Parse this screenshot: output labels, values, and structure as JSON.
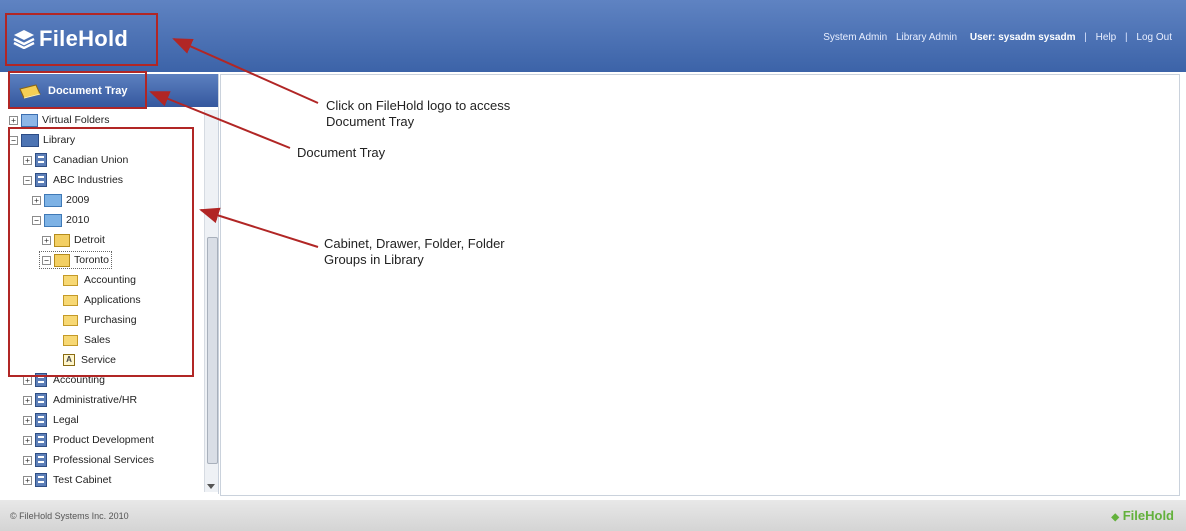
{
  "header": {
    "logo_text": "FileHold",
    "nav": [
      "System Admin",
      "Library Admin"
    ],
    "user_label": "User: sysadm sysadm",
    "separator": "|",
    "help": "Help",
    "logout": "Log Out"
  },
  "sidebar": {
    "document_tray_label": "Document Tray",
    "tree": [
      {
        "label": "Virtual Folders",
        "icon": "virtual-folder-icon",
        "expander": "+"
      },
      {
        "label": "Library",
        "icon": "library-icon",
        "expander": "−"
      },
      {
        "label": "Canadian Union",
        "icon": "cabinet-icon",
        "expander": "+"
      },
      {
        "label": "ABC Industries",
        "icon": "cabinet-icon",
        "expander": "−"
      },
      {
        "label": "2009",
        "icon": "drawer-icon",
        "expander": "+"
      },
      {
        "label": "2010",
        "icon": "drawer-icon",
        "expander": "−"
      },
      {
        "label": "Detroit",
        "icon": "folder-group-icon",
        "expander": "+"
      },
      {
        "label": "Toronto",
        "icon": "folder-group-icon",
        "expander": "−"
      },
      {
        "label": "Accounting",
        "icon": "folder-icon",
        "expander": ""
      },
      {
        "label": "Applications",
        "icon": "folder-icon",
        "expander": ""
      },
      {
        "label": "Purchasing",
        "icon": "folder-icon",
        "expander": ""
      },
      {
        "label": "Sales",
        "icon": "folder-icon",
        "expander": ""
      },
      {
        "label": "Service",
        "icon": "service-folder-icon",
        "expander": ""
      },
      {
        "label": "Accounting",
        "icon": "cabinet-icon",
        "expander": "+"
      },
      {
        "label": "Administrative/HR",
        "icon": "cabinet-icon",
        "expander": "+"
      },
      {
        "label": "Legal",
        "icon": "cabinet-icon",
        "expander": "+"
      },
      {
        "label": "Product Development",
        "icon": "cabinet-icon",
        "expander": "+"
      },
      {
        "label": "Professional Services",
        "icon": "cabinet-icon",
        "expander": "+"
      },
      {
        "label": "Test Cabinet",
        "icon": "cabinet-icon",
        "expander": "+"
      }
    ],
    "service_glyph": "A"
  },
  "annotations": {
    "logo_note_line1": "Click on FileHold logo to access",
    "logo_note_line2": "Document Tray",
    "tray_note": "Document Tray",
    "library_note_line1": "Cabinet, Drawer, Folder, Folder",
    "library_note_line2": "Groups in Library",
    "color": "#b12625"
  },
  "footer": {
    "copyright": "© FileHold Systems Inc. 2010",
    "logo_text": "FileHold"
  }
}
